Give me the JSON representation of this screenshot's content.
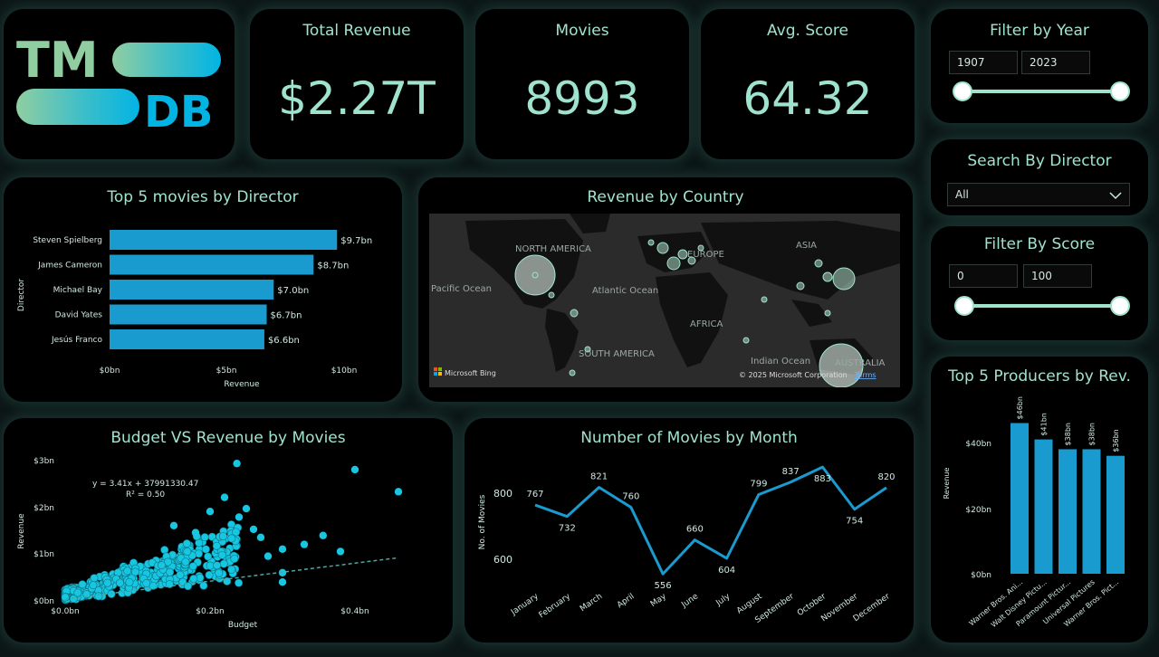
{
  "logo": {
    "text_top": "TM",
    "text_bottom": "DB"
  },
  "kpis": [
    {
      "label": "Total Revenue",
      "value": "$2.27T"
    },
    {
      "label": "Movies",
      "value": "8993"
    },
    {
      "label": "Avg. Score",
      "value": "64.32"
    }
  ],
  "filter_year": {
    "title": "Filter by Year",
    "min": "1907",
    "max": "2023",
    "low_fraction": 0.0,
    "high_fraction": 1.0
  },
  "search_director": {
    "title": "Search By Director",
    "value": "All"
  },
  "filter_score": {
    "title": "Filter By Score",
    "min": "0",
    "max": "100",
    "low_fraction": 0.0,
    "high_fraction": 1.0
  },
  "directors_chart": {
    "title": "Top 5 movies by Director",
    "ylabel": "Director",
    "xlabel": "Revenue",
    "tick_labels": [
      "$0bn",
      "$5bn",
      "$10bn"
    ]
  },
  "country_map": {
    "title": "Revenue by Country",
    "labels": [
      "NORTH AMERICA",
      "EUROPE",
      "ASIA",
      "Pacific Ocean",
      "Atlantic Ocean",
      "AFRICA",
      "SOUTH AMERICA",
      "Indian Ocean",
      "AUSTRALIA"
    ],
    "attribution": "Microsoft Bing",
    "copyright": "© 2025 Microsoft Corporation",
    "terms": "Terms"
  },
  "scatter": {
    "title": "Budget VS Revenue by Movies",
    "equation": "y = 3.41x + 37991330.47",
    "r2": "R² = 0.50",
    "xlabel": "Budget",
    "ylabel": "Revenue",
    "x_ticks": [
      "$0.0bn",
      "$0.2bn",
      "$0.4bn"
    ],
    "y_ticks": [
      "$0bn",
      "$1bn",
      "$2bn",
      "$3bn"
    ]
  },
  "monthly": {
    "title": "Number of Movies by Month",
    "ylabel": "No. of Movies",
    "y_ticks": [
      "600",
      "800"
    ]
  },
  "producers": {
    "title": "Top 5 Producers by Rev.",
    "ylabel": "Revenue",
    "y_ticks": [
      "$0bn",
      "$20bn",
      "$40bn"
    ]
  },
  "chart_data": [
    {
      "type": "bar",
      "title": "Top 5 movies by Director",
      "categories": [
        "Steven Spielberg",
        "James Cameron",
        "Michael Bay",
        "David Yates",
        "Jesús Franco"
      ],
      "values": [
        9.7,
        8.7,
        7.0,
        6.7,
        6.6
      ],
      "value_labels": [
        "$9.7bn",
        "$8.7bn",
        "$7.0bn",
        "$6.7bn",
        "$6.6bn"
      ],
      "xlabel": "Revenue",
      "ylabel": "Director",
      "xlim": [
        0,
        10
      ],
      "orientation": "horizontal",
      "color": "#1a9bd0"
    },
    {
      "type": "line",
      "title": "Number of Movies by Month",
      "categories": [
        "January",
        "February",
        "March",
        "April",
        "May",
        "June",
        "July",
        "August",
        "September",
        "October",
        "November",
        "December"
      ],
      "values": [
        767,
        732,
        821,
        760,
        556,
        660,
        604,
        799,
        837,
        883,
        754,
        820
      ],
      "ylabel": "No. of Movies",
      "ylim": [
        540,
        900
      ],
      "color": "#1a9bd0"
    },
    {
      "type": "bar",
      "title": "Top 5 Producers by Rev.",
      "categories": [
        "Warner Bros. Ani...",
        "Walt Disney Pictu...",
        "Paramount Pictur...",
        "Universal Pictures",
        "Warner Bros. Pict..."
      ],
      "values": [
        46,
        41,
        38,
        38,
        36
      ],
      "value_labels": [
        "$46bn",
        "$41bn",
        "$38bn",
        "$38bn",
        "$36bn"
      ],
      "ylabel": "Revenue",
      "ylim": [
        0,
        50
      ],
      "color": "#1a9bd0"
    },
    {
      "type": "scatter",
      "title": "Budget VS Revenue by Movies",
      "xlabel": "Budget",
      "ylabel": "Revenue",
      "xlim": [
        0,
        0.48
      ],
      "ylim": [
        0,
        3.0
      ],
      "trendline": {
        "slope": 3.41,
        "intercept_bn": 0.038
      },
      "outliers": [
        {
          "x": 0.237,
          "y": 2.92
        },
        {
          "x": 0.4,
          "y": 2.79
        },
        {
          "x": 0.46,
          "y": 2.32
        },
        {
          "x": 0.356,
          "y": 1.39
        },
        {
          "x": 0.26,
          "y": 1.52
        },
        {
          "x": 0.25,
          "y": 1.96
        },
        {
          "x": 0.22,
          "y": 2.2
        },
        {
          "x": 0.24,
          "y": 1.78
        },
        {
          "x": 0.3,
          "y": 1.1
        },
        {
          "x": 0.33,
          "y": 1.2
        },
        {
          "x": 0.38,
          "y": 1.05
        },
        {
          "x": 0.27,
          "y": 1.35
        },
        {
          "x": 0.2,
          "y": 1.9
        },
        {
          "x": 0.15,
          "y": 1.6
        },
        {
          "x": 0.18,
          "y": 1.45
        },
        {
          "x": 0.28,
          "y": 0.95
        },
        {
          "x": 0.3,
          "y": 0.6
        },
        {
          "x": 0.3,
          "y": 0.4
        }
      ],
      "color": "#17c6e0"
    }
  ]
}
